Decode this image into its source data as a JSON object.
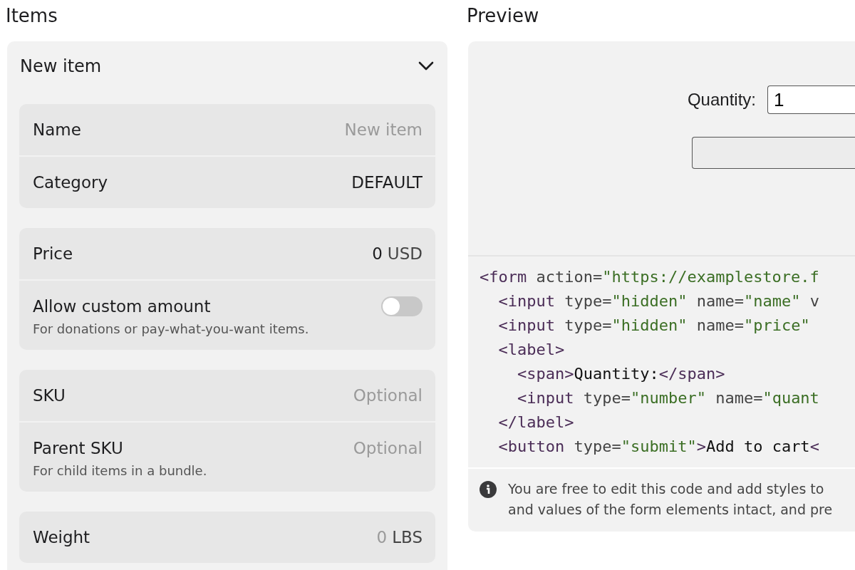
{
  "items": {
    "title": "Items",
    "card": {
      "title": "New item",
      "expanded": true,
      "groups": [
        [
          {
            "kind": "field",
            "label": "Name",
            "placeholder": "New item"
          },
          {
            "kind": "field",
            "label": "Category",
            "value": "DEFAULT"
          }
        ],
        [
          {
            "kind": "field",
            "label": "Price",
            "value": "0",
            "unit": "USD"
          },
          {
            "kind": "toggle",
            "label": "Allow custom amount",
            "hint": "For donations or pay-what-you-want items.",
            "on": false
          }
        ],
        [
          {
            "kind": "field",
            "label": "SKU",
            "placeholder": "Optional"
          },
          {
            "kind": "field",
            "label": "Parent SKU",
            "placeholder": "Optional",
            "hint": "For child items in a bundle."
          }
        ],
        [
          {
            "kind": "field",
            "label": "Weight",
            "placeholder": "0",
            "unit": "LBS"
          }
        ]
      ]
    }
  },
  "preview": {
    "title": "Preview",
    "quantity_label": "Quantity:",
    "quantity_value": "1",
    "code_lines": [
      [
        {
          "kind": "tag",
          "text": "<form"
        },
        {
          "kind": "attr",
          "text": " action="
        },
        {
          "kind": "string",
          "text": "\"https://examplestore.f"
        }
      ],
      [
        {
          "kind": "tag",
          "text": "  <input"
        },
        {
          "kind": "attr",
          "text": " type="
        },
        {
          "kind": "string",
          "text": "\"hidden\""
        },
        {
          "kind": "attr",
          "text": " name="
        },
        {
          "kind": "string",
          "text": "\"name\""
        },
        {
          "kind": "attr",
          "text": " v"
        }
      ],
      [
        {
          "kind": "tag",
          "text": "  <input"
        },
        {
          "kind": "attr",
          "text": " type="
        },
        {
          "kind": "string",
          "text": "\"hidden\""
        },
        {
          "kind": "attr",
          "text": " name="
        },
        {
          "kind": "string",
          "text": "\"price\""
        }
      ],
      [
        {
          "kind": "tag",
          "text": "  <label>"
        }
      ],
      [
        {
          "kind": "tag",
          "text": "    <span>"
        },
        {
          "kind": "text",
          "text": "Quantity:"
        },
        {
          "kind": "tag",
          "text": "</span>"
        }
      ],
      [
        {
          "kind": "tag",
          "text": "    <input"
        },
        {
          "kind": "attr",
          "text": " type="
        },
        {
          "kind": "string",
          "text": "\"number\""
        },
        {
          "kind": "attr",
          "text": " name="
        },
        {
          "kind": "string",
          "text": "\"quant"
        }
      ],
      [
        {
          "kind": "tag",
          "text": "  </label>"
        }
      ],
      [
        {
          "kind": "tag",
          "text": "  <button"
        },
        {
          "kind": "attr",
          "text": " type="
        },
        {
          "kind": "string",
          "text": "\"submit\""
        },
        {
          "kind": "tag",
          "text": ">"
        },
        {
          "kind": "text",
          "text": "Add to cart"
        },
        {
          "kind": "tag",
          "text": "<"
        }
      ]
    ],
    "info_lines": [
      "You are free to edit this code and add styles to",
      "and values of the form elements intact, and pre"
    ]
  }
}
